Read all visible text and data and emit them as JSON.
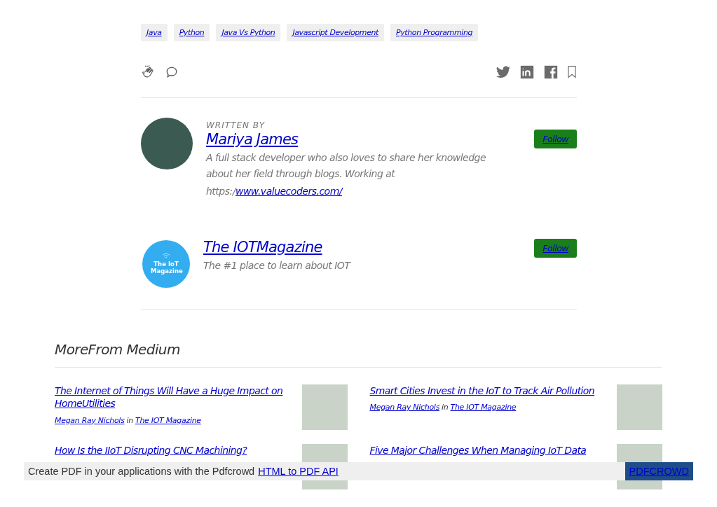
{
  "tags": [
    "Java",
    "Python",
    "Java Vs Python",
    "Javascript Development",
    "Python Programming"
  ],
  "author": {
    "eyebrow": "WRITTEN BY",
    "name": "Mariya James",
    "bio": "A full stack developer who also loves to share her knowledge about her field through blogs. Working at",
    "bio_prefix": "https:/",
    "link": "www.valuecoders.com/",
    "follow": "Follow"
  },
  "publication": {
    "logo_text": "The IoT Magazine",
    "name": "The IOTMagazine",
    "tagline": "The #1 place to learn about IOT",
    "follow": "Follow"
  },
  "more": {
    "heading": "MoreFrom Medium",
    "articles": [
      {
        "title": "The Internet of Things Will Have a Huge Impact on HomeUtilities",
        "author": "Megan Ray Nichols",
        "in": "in",
        "publication": "The IOT Magazine"
      },
      {
        "title": "Smart Cities Invest in the IoT to Track Air Pollution",
        "author": "Megan Ray Nichols",
        "in": "in",
        "publication": "The IOT Magazine"
      },
      {
        "title": "How Is the IIoT Disrupting CNC Machining?"
      },
      {
        "title": "Five Major Challenges When Managing IoT Data"
      }
    ]
  },
  "pdf_bar": {
    "text": "Create PDF in your applications with the Pdfcrowd",
    "link": "HTML to PDF API",
    "button": "PDFCROWD"
  }
}
